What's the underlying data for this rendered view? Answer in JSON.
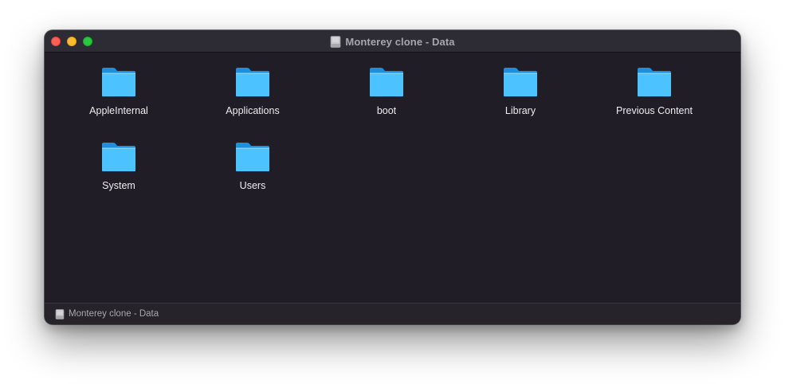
{
  "window": {
    "title": "Monterey clone - Data",
    "title_icon": "external-drive-icon"
  },
  "items": [
    {
      "label": "AppleInternal",
      "icon": "folder-icon"
    },
    {
      "label": "Applications",
      "icon": "folder-icon"
    },
    {
      "label": "boot",
      "icon": "folder-icon"
    },
    {
      "label": "Library",
      "icon": "folder-icon"
    },
    {
      "label": "Previous Content",
      "icon": "folder-icon"
    },
    {
      "label": "System",
      "icon": "folder-icon"
    },
    {
      "label": "Users",
      "icon": "folder-icon"
    }
  ],
  "statusbar": {
    "path_label": "Monterey clone - Data",
    "path_icon": "external-drive-icon"
  },
  "colors": {
    "window_background": "#201d26",
    "folder_blue": "#4cc2ff",
    "close": "#fe5f57",
    "minimize": "#febc2e",
    "zoom": "#28c840"
  }
}
